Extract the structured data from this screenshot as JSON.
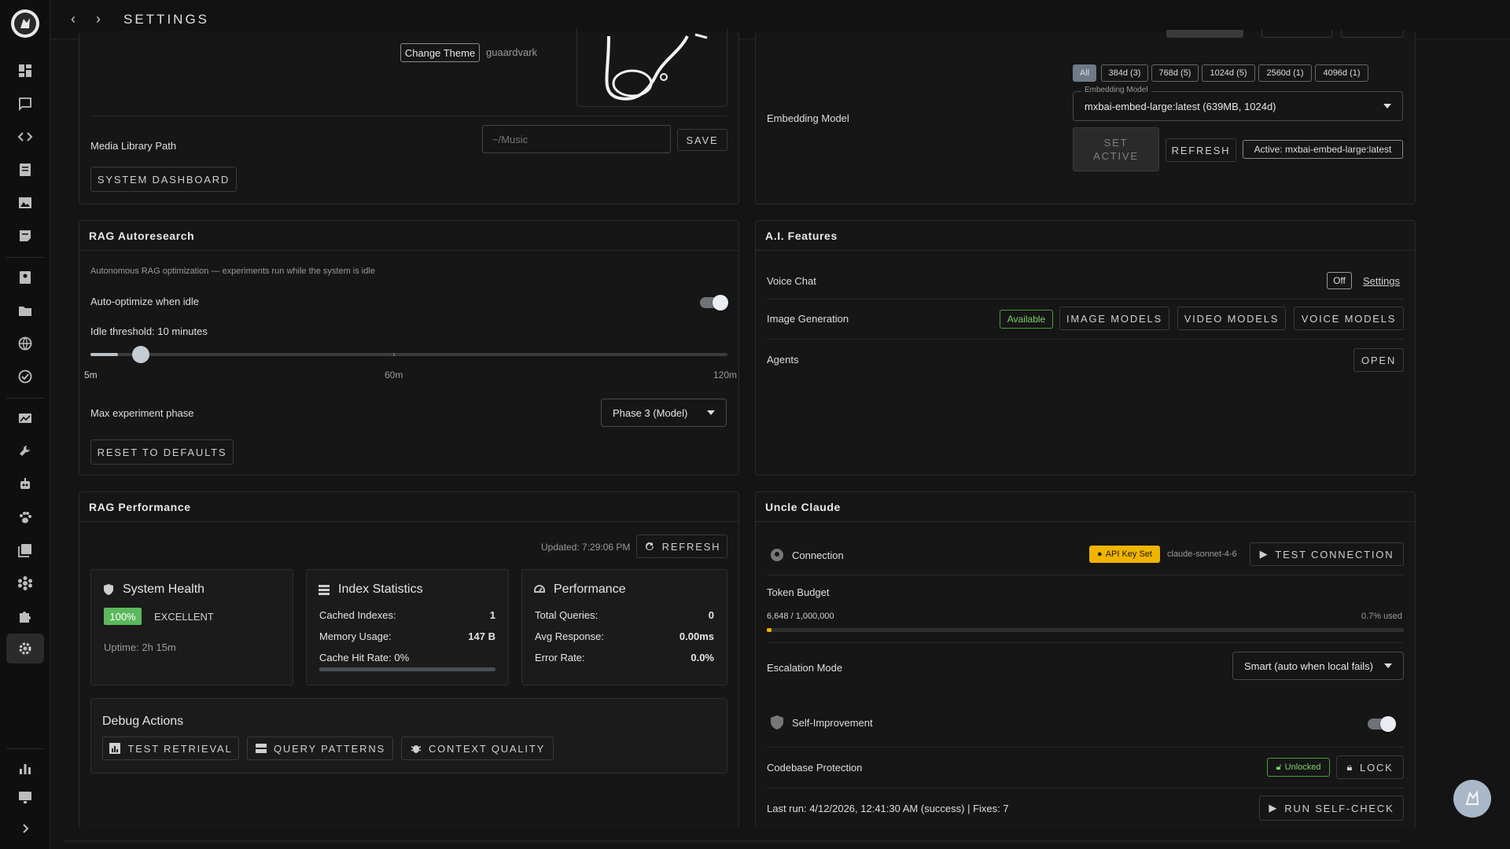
{
  "header": {
    "title": "SETTINGS"
  },
  "appearance": {
    "change_theme": "Change Theme",
    "theme_name": "guaardvark",
    "media_label": "Media Library Path",
    "media_placeholder": "~/Music",
    "save": "SAVE",
    "dashboard": "SYSTEM DASHBOARD"
  },
  "embedding": {
    "filters": [
      "All",
      "384d (3)",
      "768d (5)",
      "1024d (5)",
      "2560d (1)",
      "4096d (1)"
    ],
    "label": "Embedding Model",
    "field_label": "Embedding Model",
    "selected": "mxbai-embed-large:latest (639MB, 1024d)",
    "set_active_1": "SET",
    "set_active_2": "ACTIVE",
    "refresh": "REFRESH",
    "active_badge": "Active: mxbai-embed-large:latest"
  },
  "rag_auto": {
    "title": "RAG Autoresearch",
    "desc": "Autonomous RAG optimization — experiments run while the system is idle",
    "auto_label": "Auto-optimize when idle",
    "auto_on": true,
    "threshold_label": "Idle threshold: 10 minutes",
    "slider_min": 5,
    "slider_max": 120,
    "slider_value": 10,
    "ticks": [
      "5m",
      "60m",
      "120m"
    ],
    "phase_label": "Max experiment phase",
    "phase_value": "Phase 3 (Model)",
    "reset": "RESET TO DEFAULTS"
  },
  "ai_features": {
    "title": "A.I. Features",
    "voice_label": "Voice Chat",
    "voice_state": "Off",
    "voice_settings": "Settings",
    "image_label": "Image Generation",
    "image_state": "Available",
    "image_models": "IMAGE MODELS",
    "video_models": "VIDEO MODELS",
    "voice_models": "VOICE MODELS",
    "agents_label": "Agents",
    "agents_open": "OPEN"
  },
  "rag_perf": {
    "title": "RAG Performance",
    "updated": "Updated: 7:29:06 PM",
    "refresh": "REFRESH",
    "health": {
      "title": "System Health",
      "percent": "100%",
      "status": "EXCELLENT",
      "uptime": "Uptime: 2h 15m"
    },
    "index": {
      "title": "Index Statistics",
      "cached_label": "Cached Indexes:",
      "cached_value": "1",
      "memory_label": "Memory Usage:",
      "memory_value": "147 B",
      "hit_label": "Cache Hit Rate: 0%",
      "hit_fraction": 0
    },
    "perf": {
      "title": "Performance",
      "queries_label": "Total Queries:",
      "queries_value": "0",
      "avg_label": "Avg Response:",
      "avg_value": "0.00ms",
      "err_label": "Error Rate:",
      "err_value": "0.0%"
    },
    "debug": {
      "title": "Debug Actions",
      "test": "TEST RETRIEVAL",
      "patterns": "QUERY PATTERNS",
      "quality": "CONTEXT QUALITY"
    }
  },
  "claude": {
    "title": "Uncle Claude",
    "conn_label": "Connection",
    "api_badge": "API Key Set",
    "model": "claude-sonnet-4-6",
    "test": "TEST CONNECTION",
    "budget_label": "Token Budget",
    "budget_used": "6,648 / 1,000,000",
    "budget_pct": "0.7% used",
    "budget_fraction": 0.007,
    "esc_label": "Escalation Mode",
    "esc_value": "Smart (auto when local fails)",
    "self_label": "Self-Improvement",
    "self_on": true,
    "protect_label": "Codebase Protection",
    "unlocked": "Unlocked",
    "lock": "LOCK",
    "last_run": "Last run: 4/12/2026, 12:41:30 AM (success) | Fixes: 7",
    "self_check": "RUN SELF-CHECK"
  },
  "colors": {
    "accent_green": "#6bbf59",
    "amber": "#f0b400",
    "panel": "#161616"
  }
}
